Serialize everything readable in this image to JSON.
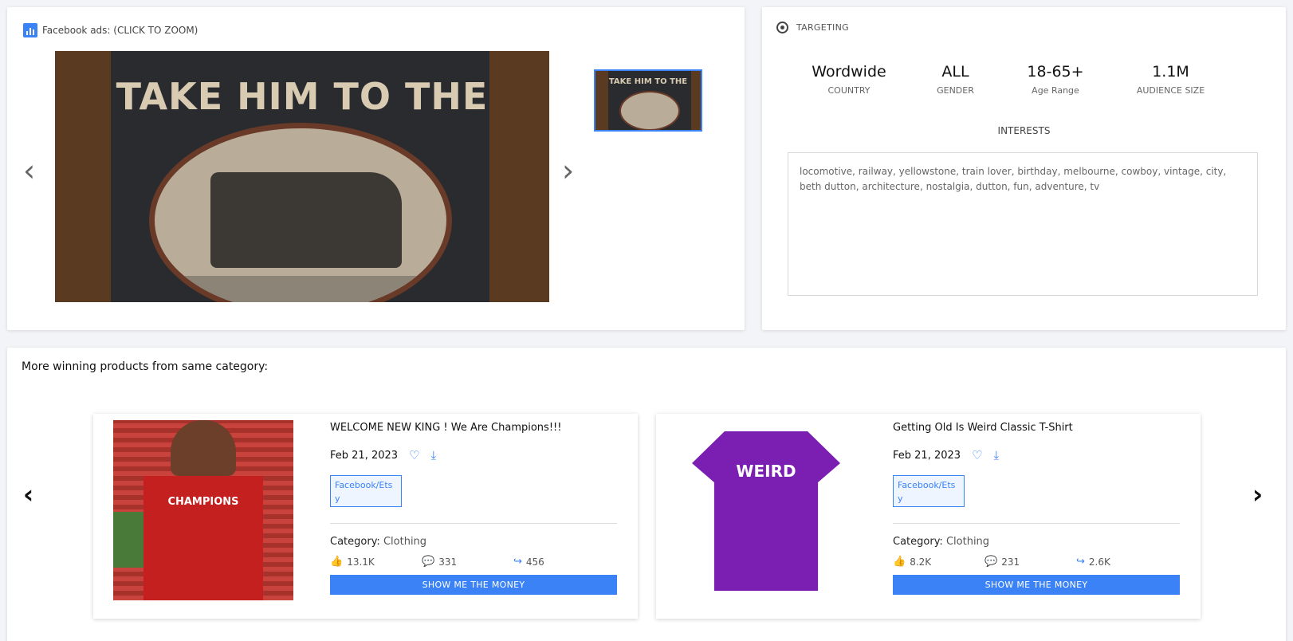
{
  "ads_panel": {
    "title": "Facebook ads: (CLICK TO ZOOM)",
    "image_headline": "TAKE HIM TO THE",
    "thumb_headline": "TAKE HIM TO THE",
    "prev_arrow": "‹",
    "next_arrow": "›",
    "icon": "bar-chart-icon"
  },
  "targeting": {
    "title": "TARGETING",
    "icon": "target-icon",
    "stats": [
      {
        "value": "Wordwide",
        "label": "COUNTRY"
      },
      {
        "value": "ALL",
        "label": "GENDER"
      },
      {
        "value": "18-65+",
        "label": "Age Range"
      },
      {
        "value": "1.1M",
        "label": "AUDIENCE SIZE"
      }
    ],
    "interests_label": "INTERESTS",
    "interests": "locomotive, railway, yellowstone, train lover, birthday, melbourne, cowboy, vintage, city, beth dutton, architecture, nostalgia, dutton, fun, adventure, tv"
  },
  "products": {
    "title": "More winning products from same category:",
    "prev_arrow": "‹",
    "next_arrow": "›",
    "items": [
      {
        "name": "WELCOME NEW KING ! We Are Champions!!!",
        "date": "Feb 21, 2023",
        "source": "Facebook/Etsy",
        "category_label": "Category:",
        "category": "Clothing",
        "likes": "13.1K",
        "comments": "331",
        "shares": "456",
        "button": "SHOW ME THE MONEY",
        "image_text": "CHAMPIONS"
      },
      {
        "name": "Getting Old Is Weird Classic T-Shirt",
        "date": "Feb 21, 2023",
        "source": "Facebook/Etsy",
        "category_label": "Category:",
        "category": "Clothing",
        "likes": "8.2K",
        "comments": "231",
        "shares": "2.6K",
        "button": "SHOW ME THE MONEY",
        "image_text": "WEIRD"
      }
    ]
  },
  "colors": {
    "accent": "#3b82f6",
    "background": "#f3f4f8"
  }
}
